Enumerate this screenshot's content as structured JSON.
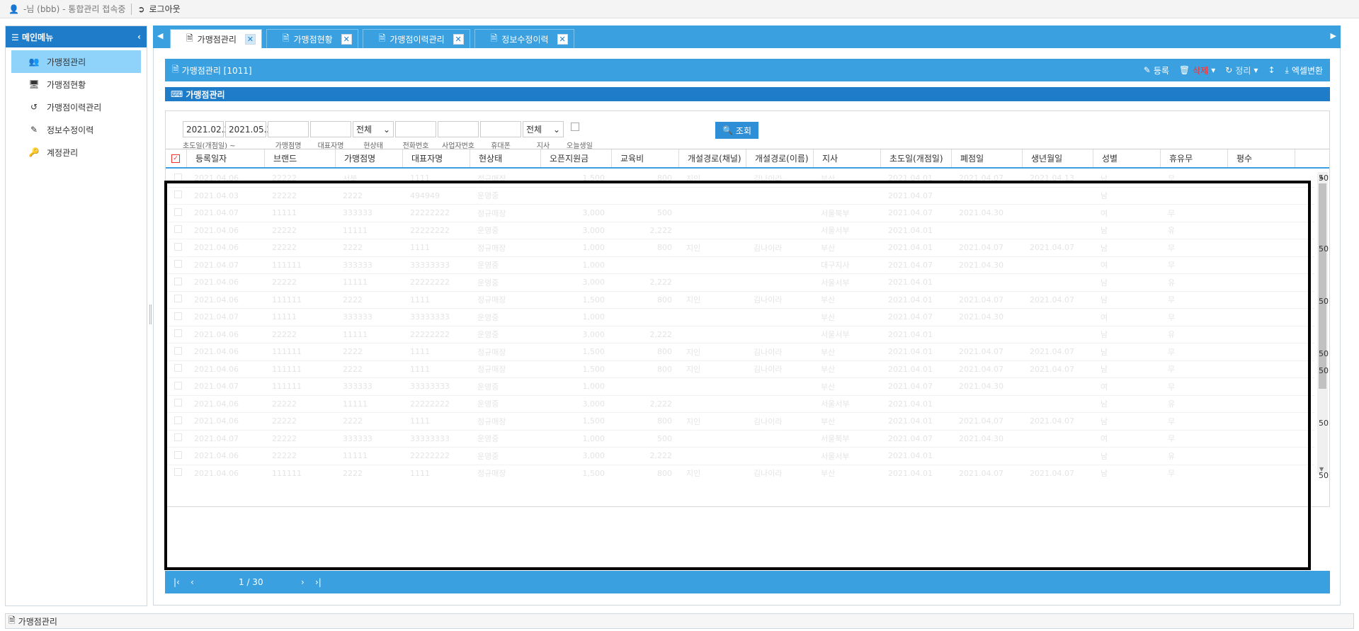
{
  "topbar": {
    "user_text": "-님 (bbb) - 통합관리 접속중",
    "logout_label": "로그아웃"
  },
  "sidebar": {
    "title": "메인메뉴",
    "items": [
      {
        "label": "가맹점관리",
        "icon": "users-icon"
      },
      {
        "label": "가맹점현황",
        "icon": "monitor-icon"
      },
      {
        "label": "가맹점이력관리",
        "icon": "history-icon"
      },
      {
        "label": "정보수정이력",
        "icon": "edit-icon"
      },
      {
        "label": "계정관리",
        "icon": "key-icon"
      }
    ]
  },
  "tabs": [
    {
      "label": "가맹점관리",
      "active": true
    },
    {
      "label": "가맹점현황",
      "active": false
    },
    {
      "label": "가맹점이력관리",
      "active": false
    },
    {
      "label": "정보수정이력",
      "active": false
    }
  ],
  "panel": {
    "title": "가맹점관리 [1011]",
    "register_label": "등록",
    "delete_label": "삭제",
    "sort_label": "정리",
    "excel_label": "엑셀변환",
    "subtitle": "가맹점관리"
  },
  "filters": {
    "date_from": "2021.02.26",
    "date_to": "2021.05.26",
    "date_caption": "초도일(개점일) ~",
    "name_caption": "가맹점명",
    "owner_caption": "대표자명",
    "status_value": "전체",
    "status_caption": "현상태",
    "phone_caption": "전화번호",
    "biz_caption": "사업자번호",
    "mobile_caption": "휴대폰",
    "branch_value": "전체",
    "branch_caption": "지사",
    "today_caption": "오늘생일",
    "search_label": "조회"
  },
  "grid": {
    "columns": [
      "등록일자",
      "브랜드",
      "가맹점명",
      "대표자명",
      "현상태",
      "오픈지원금",
      "교육비",
      "개설경로(채널)",
      "개설경로(이름)",
      "지사",
      "초도일(개점일)",
      "폐점일",
      "생년월일",
      "성별",
      "휴유무",
      "평수"
    ],
    "rows": [
      [
        "2021.04.06",
        "22222",
        "서북",
        "1111",
        "정규매장",
        "1,500",
        "800",
        "지인",
        "김나이라",
        "부산",
        "2021.04.01",
        "2021.04.07",
        "2021.04.13",
        "남",
        "무"
      ],
      [
        "2021.04.03",
        "22222",
        "2222",
        "494949",
        "운영중",
        "",
        "",
        "",
        "",
        "",
        "2021.04.07",
        "",
        "",
        "남",
        ""
      ],
      [
        "2021.04.07",
        "11111",
        "333333",
        "22222222",
        "정규매장",
        "3,000",
        "500",
        "",
        "",
        "서울북부",
        "2021.04.07",
        "2021.04.30",
        "",
        "여",
        "무"
      ],
      [
        "2021.04.06",
        "22222",
        "11111",
        "22222222",
        "운영중",
        "3,000",
        "2,222",
        "",
        "",
        "서울서부",
        "2021.04.01",
        "",
        "",
        "남",
        "유"
      ],
      [
        "2021.04.06",
        "22222",
        "2222",
        "1111",
        "정규매장",
        "1,000",
        "800",
        "지인",
        "김나이라",
        "부산",
        "2021.04.01",
        "2021.04.07",
        "2021.04.07",
        "남",
        "무"
      ],
      [
        "2021.04.07",
        "111111",
        "333333",
        "33333333",
        "운영중",
        "1,000",
        "",
        "",
        "",
        "대구지사",
        "2021.04.07",
        "2021.04.30",
        "",
        "여",
        "무"
      ],
      [
        "2021.04.06",
        "22222",
        "11111",
        "22222222",
        "운영중",
        "3,000",
        "2,222",
        "",
        "",
        "서울서부",
        "2021.04.01",
        "",
        "",
        "남",
        "유"
      ],
      [
        "2021.04.06",
        "111111",
        "2222",
        "1111",
        "정규매장",
        "1,500",
        "800",
        "지인",
        "김나이라",
        "부산",
        "2021.04.01",
        "2021.04.07",
        "2021.04.07",
        "남",
        "무"
      ],
      [
        "2021.04.07",
        "11111",
        "333333",
        "33333333",
        "운영중",
        "1,000",
        "",
        "",
        "",
        "부산",
        "2021.04.07",
        "2021.04.30",
        "",
        "여",
        "무"
      ],
      [
        "2021.04.06",
        "22222",
        "11111",
        "22222222",
        "운영중",
        "3,000",
        "2,222",
        "",
        "",
        "서울서부",
        "2021.04.01",
        "",
        "",
        "남",
        "유"
      ],
      [
        "2021.04.06",
        "111111",
        "2222",
        "1111",
        "정규매장",
        "1,500",
        "800",
        "지인",
        "김나이라",
        "부산",
        "2021.04.01",
        "2021.04.07",
        "2021.04.07",
        "남",
        "무"
      ],
      [
        "2021.04.06",
        "111111",
        "2222",
        "1111",
        "정규매장",
        "1,500",
        "800",
        "지인",
        "김나이라",
        "부산",
        "2021.04.01",
        "2021.04.07",
        "2021.04.07",
        "남",
        "무"
      ],
      [
        "2021.04.07",
        "111111",
        "333333",
        "33333333",
        "운영중",
        "1,000",
        "",
        "",
        "",
        "부산",
        "2021.04.07",
        "2021.04.30",
        "",
        "여",
        "무"
      ],
      [
        "2021.04.06",
        "22222",
        "11111",
        "22222222",
        "운영중",
        "3,000",
        "2,222",
        "",
        "",
        "서울서부",
        "2021.04.01",
        "",
        "",
        "남",
        "유"
      ],
      [
        "2021.04.06",
        "22222",
        "2222",
        "1111",
        "정규매장",
        "1,500",
        "800",
        "지인",
        "김나이라",
        "부산",
        "2021.04.01",
        "2021.04.07",
        "2021.04.07",
        "남",
        "무"
      ],
      [
        "2021.04.07",
        "22222",
        "333333",
        "33333333",
        "운영중",
        "1,000",
        "500",
        "",
        "",
        "서울북부",
        "2021.04.07",
        "2021.04.30",
        "",
        "여",
        "무"
      ],
      [
        "2021.04.06",
        "22222",
        "11111",
        "22222222",
        "운영중",
        "3,000",
        "2,222",
        "",
        "",
        "서울서부",
        "2021.04.01",
        "",
        "",
        "남",
        "유"
      ],
      [
        "2021.04.06",
        "111111",
        "2222",
        "1111",
        "정규매장",
        "1,500",
        "800",
        "지인",
        "김나이라",
        "부산",
        "2021.04.01",
        "2021.04.07",
        "2021.04.07",
        "남",
        "무"
      ]
    ],
    "edge_values": [
      "50",
      "50",
      "50",
      "50",
      "50",
      "50",
      "50"
    ]
  },
  "pager": {
    "page_text": "1 / 30"
  },
  "statusbar": {
    "label": "가맹점관리"
  }
}
